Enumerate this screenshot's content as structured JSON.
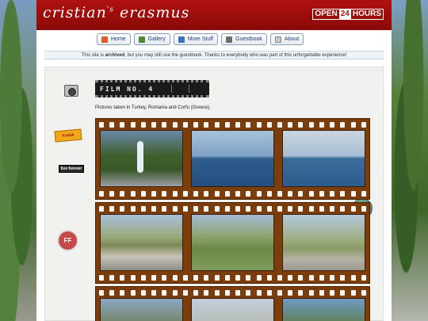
{
  "header": {
    "logo_main": "cristian",
    "logo_apos": "'s",
    "logo_last": "erasmus",
    "badge_left": "OPEN",
    "badge_mid": "24",
    "badge_right": "HOURS",
    "accent": "#b0110f"
  },
  "nav": {
    "items": [
      {
        "label": "Home",
        "icon": "home-icon"
      },
      {
        "label": "Gallery",
        "icon": "gallery-icon"
      },
      {
        "label": "More Stuff",
        "icon": "more-stuff-icon"
      },
      {
        "label": "Guestbook",
        "icon": "guestbook-icon"
      },
      {
        "label": "About",
        "icon": "about-icon"
      }
    ]
  },
  "notice": {
    "pre": "This site is ",
    "bold": "archived",
    "post": ", but you may still use the guestbook. Thanks to everybody who was part of this unforgettable experience!"
  },
  "album": {
    "title": "FILM NO. 4",
    "caption": "Pictures taken in Turkey, Romania and Corfu (Greece).",
    "stickers": {
      "kodak": "Kodak",
      "live": "live forever",
      "ff": "FF"
    }
  }
}
